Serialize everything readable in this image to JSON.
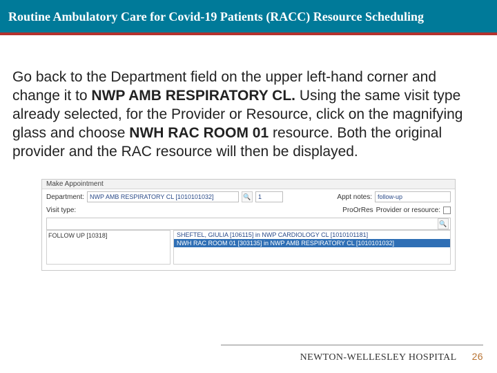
{
  "header": {
    "title": "Routine Ambulatory Care for Covid-19 Patients (RACC) Resource Scheduling"
  },
  "body": {
    "p1a": "Go back to the Department field on the upper left-hand corner and change it to ",
    "p1b": "NWP AMB RESPIRATORY CL. ",
    "p1c": "Using the same visit type already selected, for the Provider or Resource, click on the magnifying glass and choose ",
    "p1d": "NWH RAC ROOM 01 ",
    "p1e": "resource. Both the original provider and the RAC resource will then be displayed."
  },
  "shot": {
    "windowTitle": "Make Appointment",
    "deptLabel": "Department:",
    "deptValue": "NWP AMB RESPIRATORY CL [1010101032]",
    "apptNotesLabel": "Appt notes:",
    "apptNotesValue": "follow-up",
    "unitsLabel": "1",
    "visitLabel": "Visit type:",
    "providerLabel": "Provider or resource:",
    "providerHeader": "ProOrRes",
    "visitTypeItem": "FOLLOW UP [10318]",
    "resultRow1": "SHEFTEL, GIULIA   [106115] in NWP CARDIOLOGY CL [1010101181]",
    "resultRow2": "NWH RAC ROOM 01 [303135] in NWP AMB RESPIRATORY CL [1010101032]"
  },
  "footer": {
    "org": "NEWTON-WELLESLEY HOSPITAL",
    "page": "26"
  }
}
